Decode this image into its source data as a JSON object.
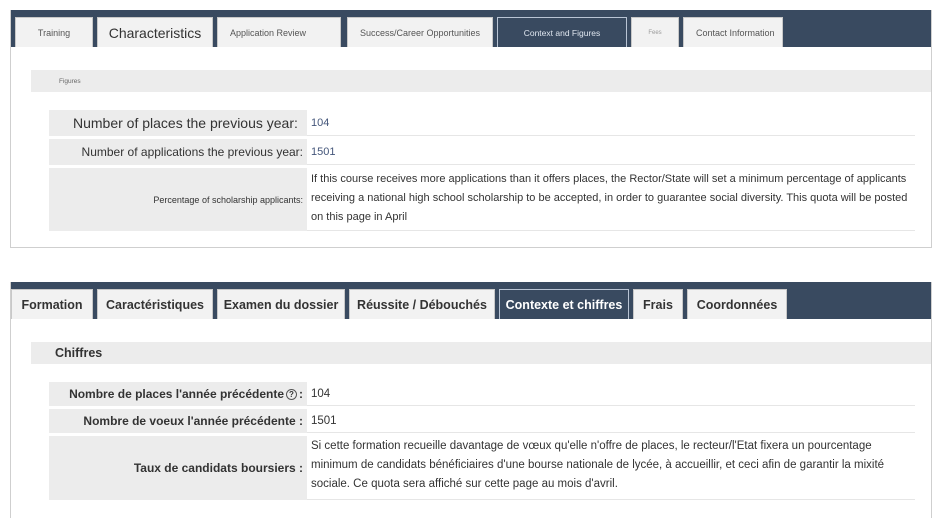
{
  "english": {
    "tabs": [
      {
        "label": "Training"
      },
      {
        "label": "Characteristics"
      },
      {
        "label": "Application Review"
      },
      {
        "label": "Success/Career Opportunities"
      },
      {
        "label": "Context and Figures"
      },
      {
        "label": "Fees"
      },
      {
        "label": "Contact Information"
      }
    ],
    "section_title": "Figures",
    "rows": [
      {
        "label": "Number of places the previous year:",
        "value": "104"
      },
      {
        "label": "Number of applications the previous year:",
        "value": "1501"
      },
      {
        "label": "Percentage of scholarship applicants:",
        "value": "If this course receives more applications than it offers places, the Rector/State will set a minimum percentage of applicants receiving a national high school scholarship to be accepted, in order to guarantee social diversity. This quota will be posted on this page in April"
      }
    ]
  },
  "french": {
    "tabs": [
      {
        "label": "Formation"
      },
      {
        "label": "Caractéristiques"
      },
      {
        "label": "Examen du dossier"
      },
      {
        "label": "Réussite / Débouchés"
      },
      {
        "label": "Contexte et chiffres"
      },
      {
        "label": "Frais"
      },
      {
        "label": "Coordonnées"
      }
    ],
    "section_title": "Chiffres",
    "rows": [
      {
        "label": "Nombre de places l'année précédente",
        "suffix": ":",
        "value": "104"
      },
      {
        "label": "Nombre de voeux l'année précédente :",
        "value": "1501"
      },
      {
        "label": "Taux de candidats boursiers :",
        "value": "Si cette formation recueille davantage de vœux qu'elle n'offre de places, le recteur/l'Etat fixera un pourcentage minimum de candidats bénéficiaires d'une bourse nationale de lycée, à accueillir, et ceci afin de garantir la mixité sociale. Ce quota sera affiché sur cette page au mois d'avril."
      }
    ]
  },
  "colors": {
    "tabbar": "#394a60",
    "section_bg": "#ececec",
    "value_text": "#44567a"
  }
}
